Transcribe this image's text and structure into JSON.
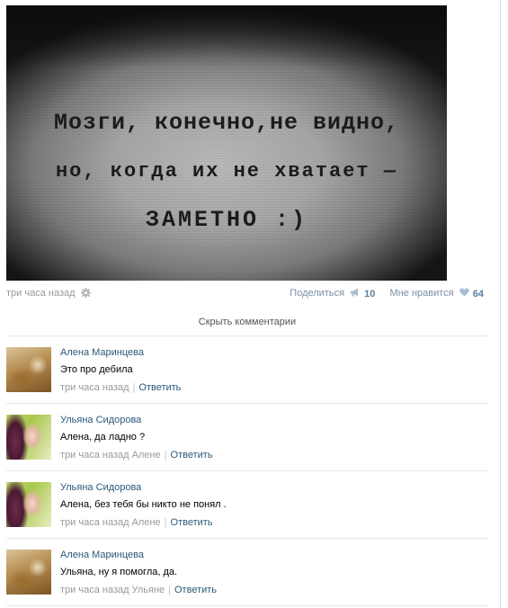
{
  "post": {
    "image_text": {
      "line1": "Мозги, конечно,не видно,",
      "line2": "но, когда их не хватает —",
      "line3": "ЗАМЕТНО :)"
    },
    "time": "три часа назад",
    "share_label": "Поделиться",
    "share_count": "10",
    "like_label": "Мне нравится",
    "like_count": "64",
    "hide_comments": "Скрыть комментарии"
  },
  "comments": [
    {
      "author": "Алена Маринцева",
      "text": "Это про дебила",
      "time": "три часа назад",
      "reply": "Ответить",
      "avatar": "alena-avatar"
    },
    {
      "author": "Ульяна Сидорова",
      "text": "Алена, да ладно ?",
      "time": "три часа назад Алене",
      "reply": "Ответить",
      "avatar": "ulyana-avatar"
    },
    {
      "author": "Ульяна Сидорова",
      "text": "Алена, без тебя бы никто не понял .",
      "time": "три часа назад Алене",
      "reply": "Ответить",
      "avatar": "ulyana-avatar"
    },
    {
      "author": "Алена Маринцева",
      "text": "Ульяна, ну я помогла, да.",
      "time": "три часа назад Ульяне",
      "reply": "Ответить",
      "avatar": "alena-avatar"
    }
  ],
  "icons": {
    "settings": "gear-icon",
    "share": "megaphone-icon",
    "like": "heart-icon"
  },
  "colors": {
    "link": "#2b587a",
    "meta": "#999999",
    "count": "#5b7ea3"
  }
}
